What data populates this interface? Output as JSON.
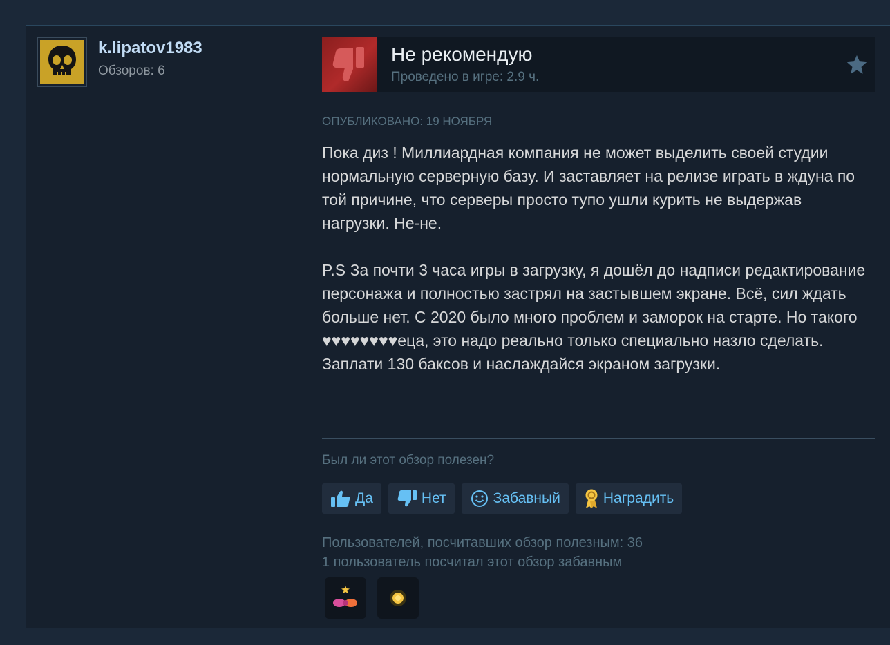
{
  "author": {
    "username": "k.lipatov1983",
    "reviews_count": "Обзоров: 6",
    "avatar_icon": "skull-icon"
  },
  "verdict": {
    "title": "Не рекомендую",
    "hours": "Проведено в игре: 2.9 ч.",
    "icon": "thumbs-down-icon"
  },
  "posted": "Опубликовано: 19 ноября",
  "review": {
    "paragraph1": "Пока диз ! Миллиардная компания не может выделить своей студии нормальную серверную базу. И заставляет на релизе играть в ждуна по той причине, что серверы просто тупо ушли курить не выдержав нагрузки. Не-не.",
    "paragraph2": "P.S За почти 3 часа игры в загрузку, я дошёл до надписи редактирование персонажа и полностью застрял на застывшем экране. Всё, сил ждать больше нет. С 2020 было много проблем и заморок на старте. Но такого ♥♥♥♥♥♥♥♥еца, это надо реально только специально назло сделать. Заплати 130 баксов и наслаждайся экраном загрузки."
  },
  "helpful": {
    "question": "Был ли этот обзор полезен?",
    "yes": "Да",
    "no": "Нет",
    "funny": "Забавный",
    "award": "Наградить"
  },
  "stats": {
    "helpful_count": "Пользователей, посчитавших обзор полезным: 36",
    "funny_count": "1 пользователь посчитал этот обзор забавным"
  },
  "colors": {
    "accent": "#66c0f4",
    "background": "#1b2838",
    "card": "#16202d",
    "negative": "#a3262a"
  }
}
